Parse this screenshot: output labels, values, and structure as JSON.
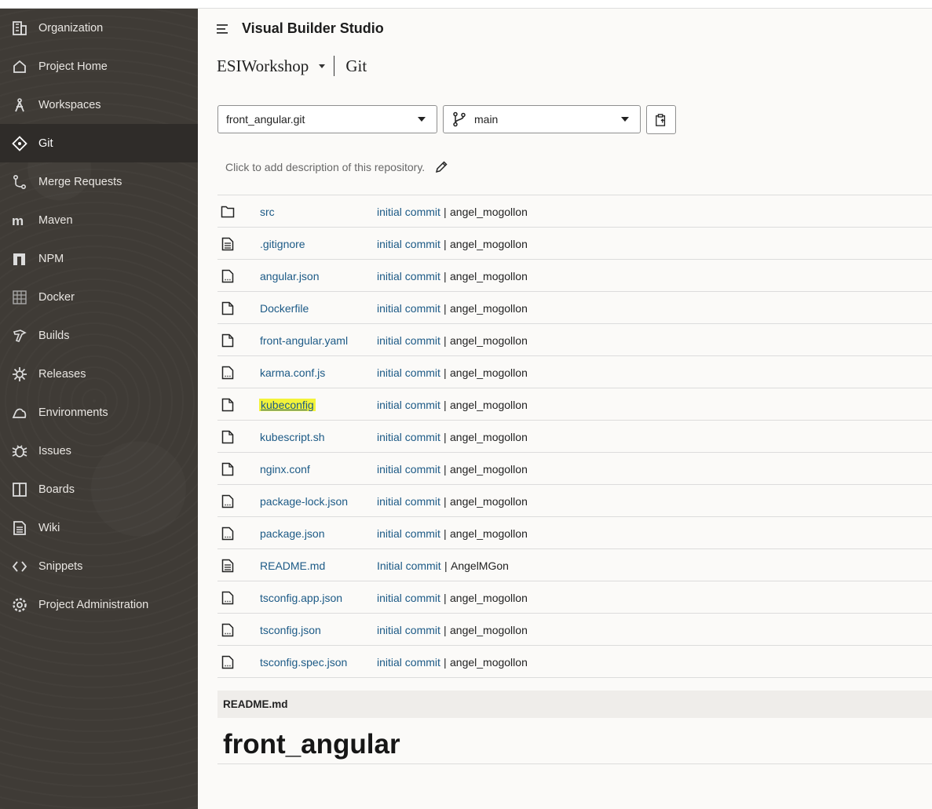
{
  "sidebar": {
    "items": [
      {
        "label": "Organization",
        "icon": "building-icon",
        "active": false
      },
      {
        "label": "Project Home",
        "icon": "home-icon",
        "active": false
      },
      {
        "label": "Workspaces",
        "icon": "compass-icon",
        "active": false
      },
      {
        "label": "Git",
        "icon": "git-icon",
        "active": true
      },
      {
        "label": "Merge Requests",
        "icon": "merge-icon",
        "active": false
      },
      {
        "label": "Maven",
        "icon": "maven-icon",
        "active": false
      },
      {
        "label": "NPM",
        "icon": "npm-icon",
        "active": false
      },
      {
        "label": "Docker",
        "icon": "docker-icon",
        "active": false
      },
      {
        "label": "Builds",
        "icon": "hammer-icon",
        "active": false
      },
      {
        "label": "Releases",
        "icon": "gear-badge-icon",
        "active": false
      },
      {
        "label": "Environments",
        "icon": "cloud-icon",
        "active": false
      },
      {
        "label": "Issues",
        "icon": "bug-icon",
        "active": false
      },
      {
        "label": "Boards",
        "icon": "board-icon",
        "active": false
      },
      {
        "label": "Wiki",
        "icon": "document-icon",
        "active": false
      },
      {
        "label": "Snippets",
        "icon": "code-icon",
        "active": false
      },
      {
        "label": "Project Administration",
        "icon": "settings-icon",
        "active": false
      }
    ]
  },
  "header": {
    "app_title": "Visual Builder Studio",
    "project": "ESIWorkshop",
    "section": "Git"
  },
  "repo_select": {
    "value": "front_angular.git"
  },
  "branch_select": {
    "value": "main"
  },
  "description": {
    "text": "Click to add description of this repository."
  },
  "files": [
    {
      "name": "src",
      "type": "folder-icon",
      "commit": "initial commit",
      "author": "angel_mogollon"
    },
    {
      "name": ".gitignore",
      "type": "text-file-icon",
      "commit": "initial commit",
      "author": "angel_mogollon"
    },
    {
      "name": "angular.json",
      "type": "code-file-icon",
      "commit": "initial commit",
      "author": "angel_mogollon"
    },
    {
      "name": "Dockerfile",
      "type": "file-icon",
      "commit": "initial commit",
      "author": "angel_mogollon"
    },
    {
      "name": "front-angular.yaml",
      "type": "file-icon",
      "commit": "initial commit",
      "author": "angel_mogollon"
    },
    {
      "name": "karma.conf.js",
      "type": "code-file-icon",
      "commit": "initial commit",
      "author": "angel_mogollon"
    },
    {
      "name": "kubeconfig",
      "type": "file-icon",
      "commit": "initial commit",
      "author": "angel_mogollon",
      "highlighted": true
    },
    {
      "name": "kubescript.sh",
      "type": "file-icon",
      "commit": "initial commit",
      "author": "angel_mogollon"
    },
    {
      "name": "nginx.conf",
      "type": "file-icon",
      "commit": "initial commit",
      "author": "angel_mogollon"
    },
    {
      "name": "package-lock.json",
      "type": "code-file-icon",
      "commit": "initial commit",
      "author": "angel_mogollon"
    },
    {
      "name": "package.json",
      "type": "code-file-icon",
      "commit": "initial commit",
      "author": "angel_mogollon"
    },
    {
      "name": "README.md",
      "type": "text-file-icon",
      "commit": "Initial commit",
      "author": "AngelMGon"
    },
    {
      "name": "tsconfig.app.json",
      "type": "code-file-icon",
      "commit": "initial commit",
      "author": "angel_mogollon"
    },
    {
      "name": "tsconfig.json",
      "type": "code-file-icon",
      "commit": "initial commit",
      "author": "angel_mogollon"
    },
    {
      "name": "tsconfig.spec.json",
      "type": "code-file-icon",
      "commit": "initial commit",
      "author": "angel_mogollon"
    }
  ],
  "separator": "|",
  "readme": {
    "label": "README.md",
    "heading": "front_angular"
  },
  "colors": {
    "sidebar_bg": "#3f3b36",
    "sidebar_active": "#2f2c29",
    "link": "#1c5a86",
    "highlight": "#f3f33a"
  }
}
